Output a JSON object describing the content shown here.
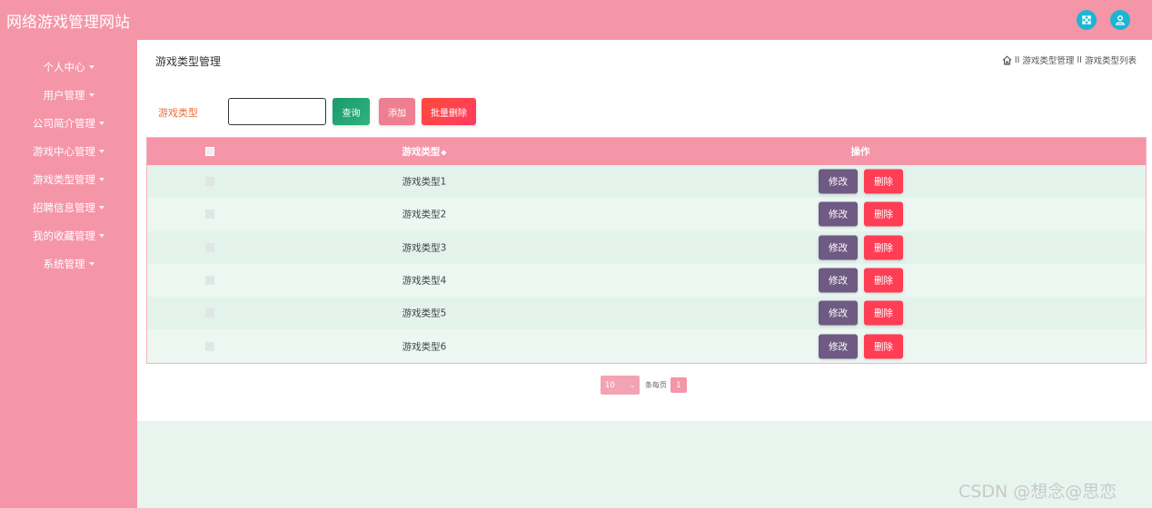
{
  "app": {
    "title": "网络游戏管理网站"
  },
  "header": {
    "icons": {
      "fullscreen": "fullscreen-icon",
      "user": "user-icon"
    },
    "icon_bg": "#1ab6d4"
  },
  "colors": {
    "brand": "#f595a8",
    "page_bg": "#e8f4ee",
    "edit": "#6e5a82",
    "delete": "#ff3d55",
    "search": "#1a9a6c"
  },
  "sidebar": {
    "items": [
      {
        "label": "个人中心"
      },
      {
        "label": "用户管理"
      },
      {
        "label": "公司简介管理"
      },
      {
        "label": "游戏中心管理"
      },
      {
        "label": "游戏类型管理"
      },
      {
        "label": "招聘信息管理"
      },
      {
        "label": "我的收藏管理"
      },
      {
        "label": "系统管理"
      }
    ]
  },
  "main": {
    "page_title": "游戏类型管理",
    "breadcrumb": {
      "sep": "II",
      "items": [
        "游戏类型管理",
        "游戏类型列表"
      ]
    },
    "filter": {
      "label": "游戏类型",
      "value": "",
      "placeholder": ""
    },
    "buttons": {
      "search": "查询",
      "add": "添加",
      "batch_delete": "批量删除"
    },
    "table": {
      "headers": {
        "name": "游戏类型",
        "actions": "操作"
      },
      "rows": [
        {
          "name": "游戏类型1"
        },
        {
          "name": "游戏类型2"
        },
        {
          "name": "游戏类型3"
        },
        {
          "name": "游戏类型4"
        },
        {
          "name": "游戏类型5"
        },
        {
          "name": "游戏类型6"
        }
      ],
      "row_actions": {
        "edit": "修改",
        "delete": "删除"
      }
    },
    "pagination": {
      "page_size": "10",
      "per_page_label": "条每页",
      "current_page": "1"
    }
  },
  "watermark": "CSDN @想念@思恋"
}
